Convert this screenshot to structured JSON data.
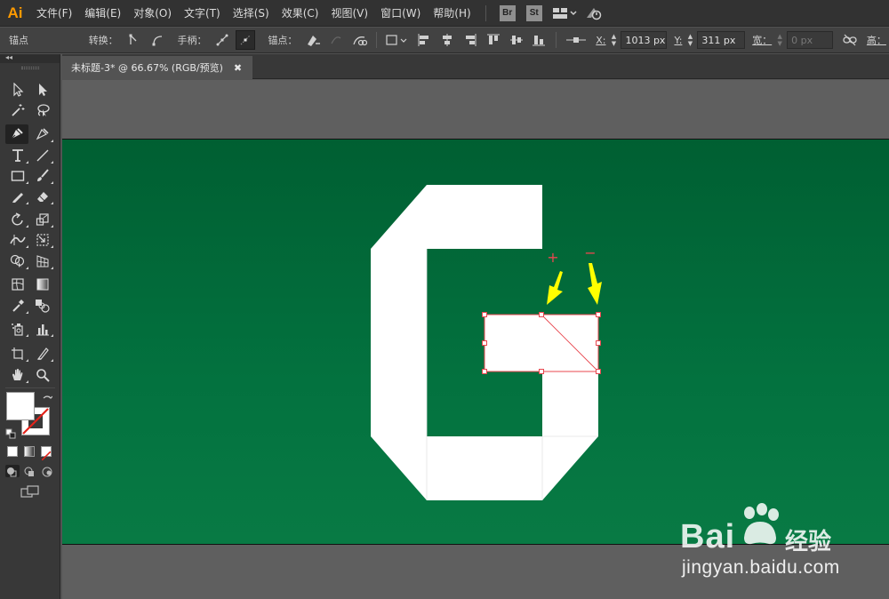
{
  "app": {
    "logo": "Ai",
    "menu": [
      "文件(F)",
      "编辑(E)",
      "对象(O)",
      "文字(T)",
      "选择(S)",
      "效果(C)",
      "视图(V)",
      "窗口(W)",
      "帮助(H)"
    ],
    "bridge_badge": "Br",
    "stock_badge": "St"
  },
  "controlbar": {
    "mode_label": "锚点",
    "convert_label": "转换：",
    "handles_label": "手柄：",
    "anchors_label": "锚点：",
    "x_label": "X:",
    "x_value": "1013 px",
    "y_label": "Y:",
    "y_value": "311 px",
    "width_label": "宽：",
    "width_value": "0 px",
    "height_label": "高："
  },
  "document": {
    "tab_title": "未标题-3* @ 66.67% (RGB/预览)",
    "close_glyph": "✖"
  },
  "canvas": {
    "plus_marker": "+",
    "minus_marker": "−",
    "artboard_color": "#006837",
    "shape_color": "#ffffff",
    "selection_color": "#e8474f",
    "arrow_color": "#ffff00"
  },
  "watermark": {
    "brand": "Bai",
    "brand_cn": "经验",
    "url": "jingyan.baidu.com"
  }
}
